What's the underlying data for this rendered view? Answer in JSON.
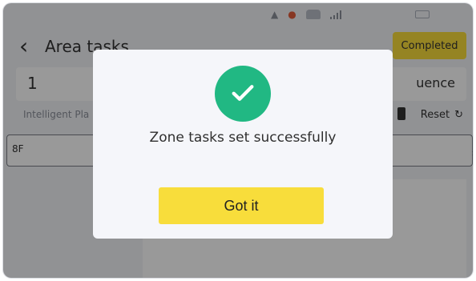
{
  "header": {
    "title": "Area tasks",
    "status_badge": "Completed"
  },
  "input_row": {
    "left_value": "1",
    "right_partial_label": "uence"
  },
  "toolbar": {
    "left_label": "Intelligent Pla",
    "reset_label": "Reset"
  },
  "floor_row": {
    "floor": "8F"
  },
  "dialog": {
    "message": "Zone tasks set successfully",
    "button_label": "Got it",
    "accent": "#21b883"
  },
  "colors": {
    "yellow": "#f8dd3b",
    "green": "#21b883"
  }
}
